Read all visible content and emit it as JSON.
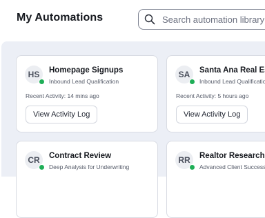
{
  "header": {
    "title": "My Automations",
    "search_placeholder": "Search automation library"
  },
  "colors": {
    "status_active": "#1fae57",
    "main_background": "#eceff6"
  },
  "cards": [
    {
      "initials": "HS",
      "title": "Homepage Signups",
      "subtitle": "Inbound Lead Qualification",
      "activity": "Recent Activity: 14 mins ago",
      "button": "View Activity Log"
    },
    {
      "initials": "SA",
      "title": "Santa Ana Real Esta",
      "subtitle": "Inbound Lead Qualificatio",
      "activity": "Recent Activity: 5 hours ago",
      "button": "View Activity Log"
    },
    {
      "initials": "CR",
      "title": "Contract Review",
      "subtitle": "Deep Analysis for Underwriting"
    },
    {
      "initials": "RR",
      "title": "Realtor Researcher",
      "subtitle": "Advanced Client Success"
    }
  ]
}
